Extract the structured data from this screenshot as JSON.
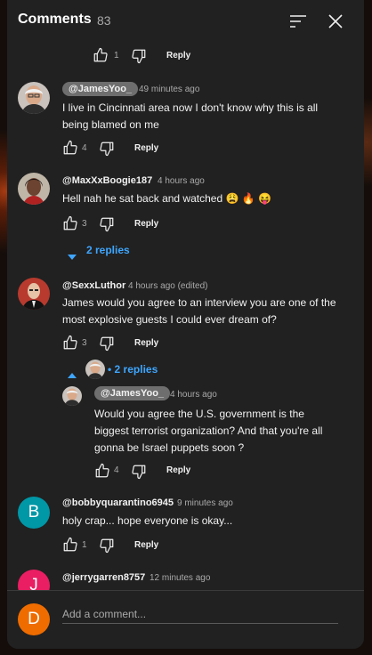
{
  "header": {
    "title": "Comments",
    "count": "83"
  },
  "top_partial": {
    "likes": "1",
    "reply_label": "Reply"
  },
  "comments": [
    {
      "author": "@JamesYoo_",
      "time": "49 minutes ago",
      "text": "I live in Cincinnati area now I don't know why this is all being blamed on me",
      "likes": "4",
      "reply_label": "Reply"
    },
    {
      "author": "@MaxXxBoogie187",
      "time": "4 hours ago",
      "text": "Hell nah he sat back and watched 😩 🔥 😝",
      "likes": "3",
      "reply_label": "Reply",
      "replies_label": "2 replies"
    },
    {
      "author": "@SexxLuthor",
      "time": "4 hours ago (edited)",
      "text": "James would you agree to an interview you are one of the most explosive guests I could ever dream of?",
      "likes": "3",
      "reply_label": "Reply",
      "replies_label": "2 replies"
    },
    {
      "author": "@bobbyquarantino6945",
      "time": "9 minutes ago",
      "text": "holy crap... hope everyone is okay...",
      "likes": "1",
      "reply_label": "Reply",
      "avatar_letter": "B",
      "avatar_color": "#0097a7"
    },
    {
      "author": "@jerrygarren8757",
      "time": "12 minutes ago",
      "avatar_letter": "J",
      "avatar_color": "#e91e63"
    }
  ],
  "nested_reply": {
    "author": "@JamesYoo_",
    "time": "4 hours ago",
    "text": "Would you agree the U.S. government is the biggest terrorist organization? And that you're all gonna be Israel puppets soon ?",
    "likes": "4",
    "reply_label": "Reply"
  },
  "footer": {
    "avatar_letter": "D",
    "avatar_color": "#ef6c00",
    "placeholder": "Add a comment..."
  },
  "colors": {
    "link": "#3ea6ff",
    "panel": "#212121",
    "muted": "#aaaaaa"
  },
  "icons": [
    "sort-icon",
    "close-icon",
    "thumbs-up-icon",
    "thumbs-down-icon",
    "caret-down-icon",
    "caret-up-icon"
  ]
}
